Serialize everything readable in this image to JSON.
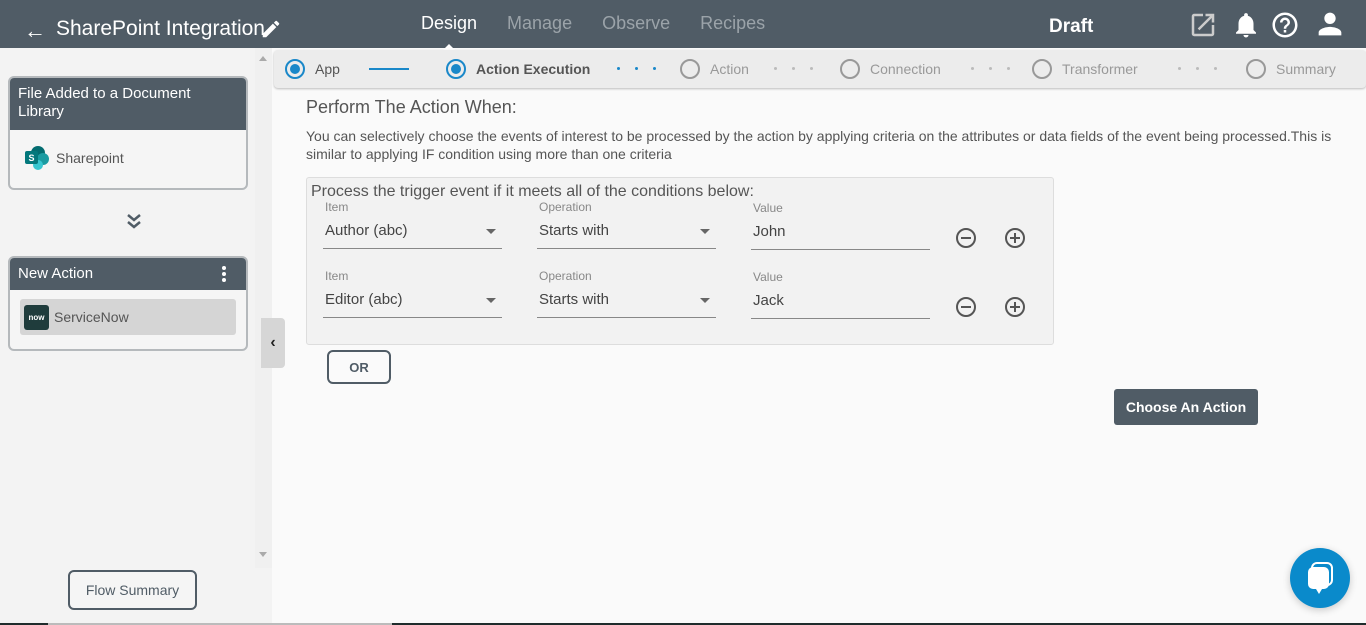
{
  "header": {
    "app_title": "SharePoint Integration",
    "nav": [
      {
        "label": "Design",
        "active": true
      },
      {
        "label": "Manage",
        "active": false
      },
      {
        "label": "Observe",
        "active": false
      },
      {
        "label": "Recipes",
        "active": false
      }
    ],
    "status": "Draft",
    "icons": [
      "back-arrow-icon",
      "pencil-icon",
      "external-link-icon",
      "bell-icon",
      "help-icon",
      "user-icon"
    ]
  },
  "sidebar": {
    "trigger_card": {
      "title": "File Added to a Document Library",
      "app": "Sharepoint"
    },
    "action_card": {
      "title": "New Action",
      "app": "ServiceNow",
      "app_logo_text": "now"
    },
    "flow_summary_label": "Flow Summary"
  },
  "stepper": {
    "steps": [
      {
        "label": "App",
        "state": "done"
      },
      {
        "label": "Action Execution",
        "state": "current"
      },
      {
        "label": "Action",
        "state": "pending"
      },
      {
        "label": "Connection",
        "state": "pending"
      },
      {
        "label": "Transformer",
        "state": "pending"
      },
      {
        "label": "Summary",
        "state": "pending"
      }
    ]
  },
  "main": {
    "title": "Perform The Action When:",
    "description": "You can selectively choose the events of interest to be processed by the action by applying criteria on the attributes or data fields of the event being processed.This is similar to applying IF condition using more than one criteria",
    "conditions_title": "Process the trigger event if it meets all of the conditions below:",
    "labels": {
      "item": "Item",
      "operation": "Operation",
      "value": "Value"
    },
    "conditions": [
      {
        "item": "Author (abc)",
        "operation": "Starts with",
        "value": "John"
      },
      {
        "item": "Editor (abc)",
        "operation": "Starts with",
        "value": "Jack"
      }
    ],
    "or_label": "OR",
    "choose_action_label": "Choose An Action"
  },
  "colors": {
    "header_bg": "#505c66",
    "accent": "#1a88c9",
    "chat_button": "#0a8acb"
  }
}
